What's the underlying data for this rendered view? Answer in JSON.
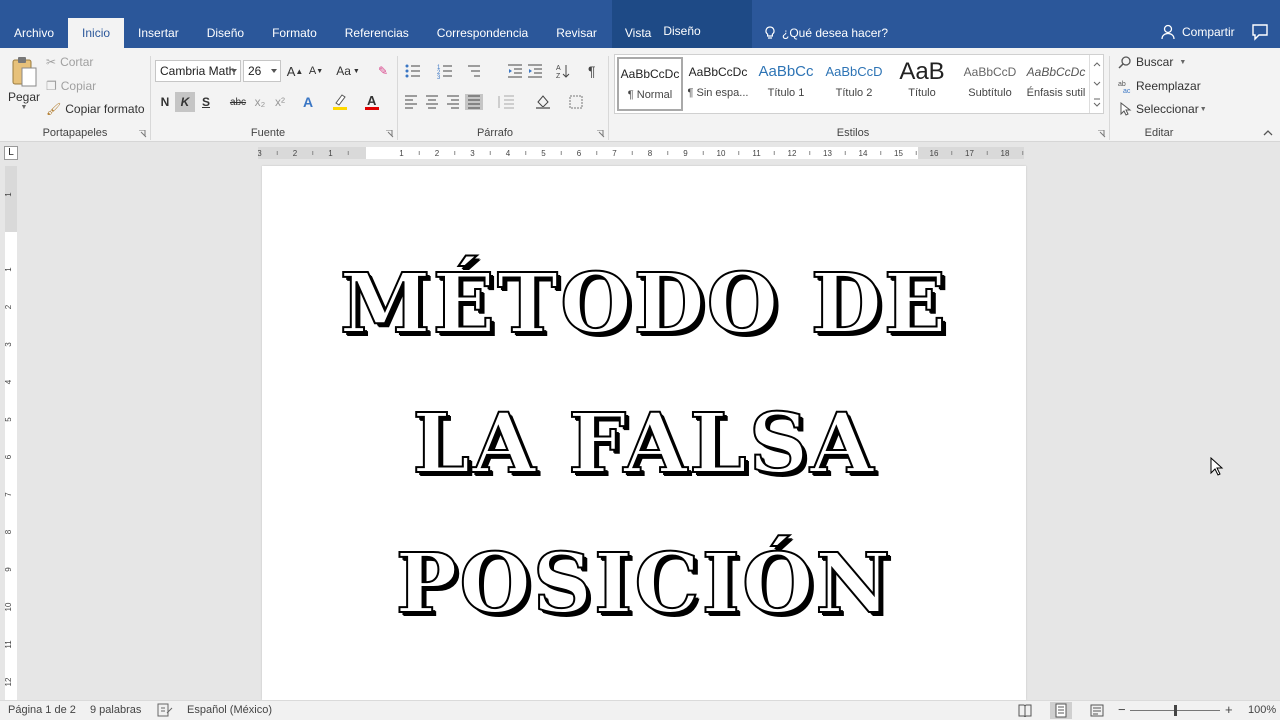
{
  "tabs": [
    {
      "label": "Archivo"
    },
    {
      "label": "Inicio",
      "active": true
    },
    {
      "label": "Insertar"
    },
    {
      "label": "Diseño"
    },
    {
      "label": "Formato"
    },
    {
      "label": "Referencias"
    },
    {
      "label": "Correspondencia"
    },
    {
      "label": "Revisar"
    },
    {
      "label": "Vista"
    }
  ],
  "context_tab": {
    "label": "Diseño"
  },
  "search": {
    "label": "¿Qué desea hacer?"
  },
  "share": {
    "label": "Compartir"
  },
  "clipboard": {
    "paste": "Pegar",
    "cut": "Cortar",
    "copy": "Copiar",
    "format_painter": "Copiar formato",
    "group_label": "Portapapeles"
  },
  "font": {
    "family": "Cambria Math",
    "size": "26",
    "case_label": "Aa",
    "bold": "N",
    "italic": "K",
    "underline": "S",
    "strike": "abc",
    "subscript": "x₂",
    "superscript": "x²",
    "group_label": "Fuente"
  },
  "paragraph": {
    "group_label": "Párrafo"
  },
  "styles": {
    "group_label": "Estilos",
    "items": [
      {
        "preview": "AaBbCcDc",
        "name": "¶ Normal",
        "selected": true
      },
      {
        "preview": "AaBbCcDc",
        "name": "¶ Sin espa..."
      },
      {
        "preview": "AaBbCc",
        "name": "Título 1"
      },
      {
        "preview": "AaBbCcD",
        "name": "Título 2"
      },
      {
        "preview": "AaB",
        "name": "Título"
      },
      {
        "preview": "AaBbCcD",
        "name": "Subtítulo"
      },
      {
        "preview": "AaBbCcDc",
        "name": "Énfasis sutil"
      }
    ]
  },
  "editing": {
    "find": "Buscar",
    "replace": "Reemplazar",
    "select": "Seleccionar",
    "group_label": "Editar"
  },
  "ruler": {
    "h_ticks": [
      "3",
      "2",
      "1",
      "1",
      "2",
      "3",
      "4",
      "5",
      "6",
      "7",
      "8",
      "9",
      "10",
      "11",
      "12",
      "13",
      "14",
      "15",
      "16",
      "17",
      "18"
    ],
    "v_ticks": [
      "1",
      "1",
      "2",
      "3",
      "4",
      "5",
      "6",
      "7",
      "8",
      "9",
      "10",
      "11",
      "12"
    ],
    "corner": "L"
  },
  "document": {
    "lines": [
      "MÉTODO DE",
      "LA FALSA",
      "POSICIÓN"
    ]
  },
  "status": {
    "page": "Página 1 de 2",
    "words": "9 palabras",
    "language": "Español (México)",
    "zoom": "100%"
  },
  "colors": {
    "title_bar": "#2b579a",
    "ribbon": "#f3f3f3",
    "canvas": "#e6e6e6",
    "highlight_yellow": "#ffd800",
    "font_red": "#e00000"
  }
}
